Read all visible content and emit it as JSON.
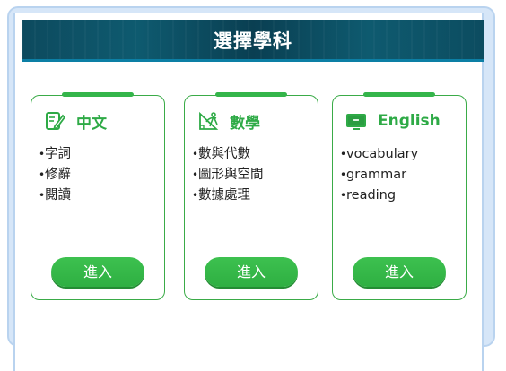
{
  "header": {
    "title": "選擇學科"
  },
  "cards": [
    {
      "title": "中文",
      "icon": "pen-notebook-icon",
      "topics": [
        "字詞",
        "修辭",
        "閱讀"
      ],
      "button_label": "進入"
    },
    {
      "title": "數學",
      "icon": "geometry-tools-icon",
      "topics": [
        "數與代數",
        "圖形與空間",
        "數據處理"
      ],
      "button_label": "進入"
    },
    {
      "title": "English",
      "icon": "abc-board-icon",
      "topics": [
        "vocabulary",
        "grammar",
        "reading"
      ],
      "button_label": "進入"
    }
  ],
  "colors": {
    "accent_green": "#2eaa46",
    "header_bg": "#0d4a5e",
    "frame_blue": "#b9d3ef"
  }
}
